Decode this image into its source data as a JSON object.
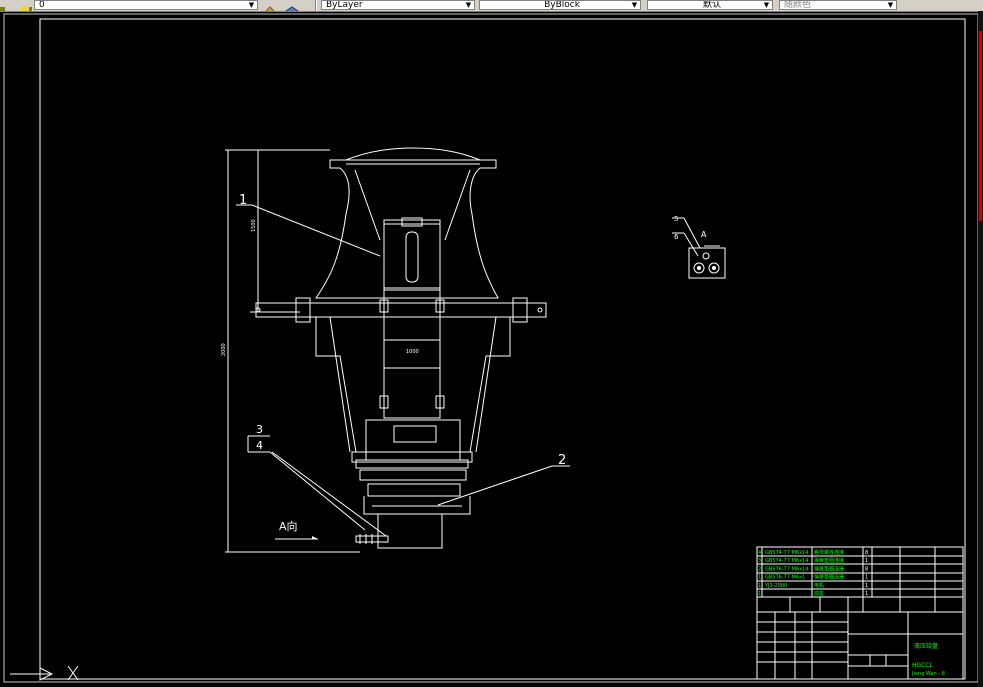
{
  "toolbar": {
    "layer_value": "0",
    "linetype_value": "ByLayer",
    "lineweight_value": "ByBlock",
    "plotstyle_value": "默认",
    "color_value": "随颜色"
  },
  "drawing": {
    "balloons": {
      "b1": "1",
      "b2": "2",
      "b3": "3",
      "b4": "4",
      "b5": "5",
      "b6": "6"
    },
    "view_label": "A",
    "view_arrow_label": "A向",
    "dim_h1": "2000",
    "dim_h2": "1500",
    "dim_shaft": "1000"
  },
  "title_block": {
    "bom_rows": [
      {
        "no": "4",
        "code": "GB574-77 M6x14",
        "name": "螺母螺栓连接",
        "qty": "8"
      },
      {
        "no": "3",
        "code": "GB574-77 M6x14",
        "name": "弹簧垫圈连接",
        "qty": "1"
      },
      {
        "no": "2",
        "code": "GB576-77 M6x14",
        "name": "弹簧垫圈连接",
        "qty": "8"
      },
      {
        "no": "1",
        "code": "GB576-77 M6x1",
        "name": "弹簧垫圈连接",
        "qty": "1"
      },
      {
        "no": "1",
        "code": "YJ3-2000",
        "name": "电机",
        "qty": "1"
      },
      {
        "no": "1",
        "code": "",
        "name": "底座",
        "qty": "1"
      }
    ],
    "company": "HGCCL",
    "drawing_no": "Jiang Wan - 8",
    "title": "液压绞盘"
  }
}
